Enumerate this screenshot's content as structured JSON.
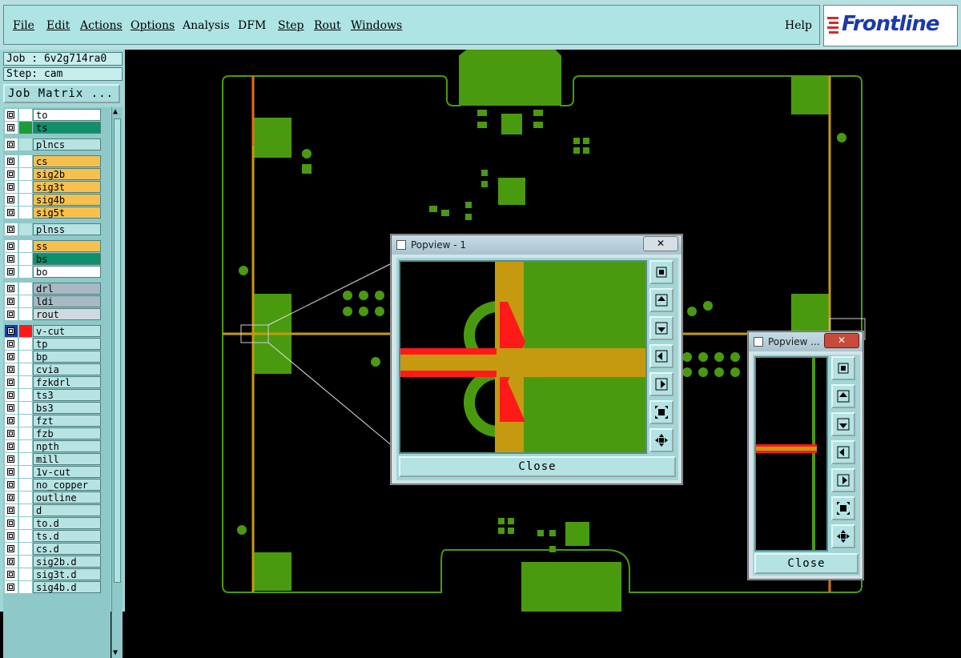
{
  "menu": {
    "file": "File",
    "edit": "Edit",
    "actions": "Actions",
    "options": "Options",
    "analysis": "Analysis",
    "dfm": "DFM",
    "step": "Step",
    "rout": "Rout",
    "windows": "Windows",
    "help": "Help"
  },
  "brand": {
    "name": "Frontline",
    "color": "#1a3aa8"
  },
  "info": {
    "job": "Job : 6v2g714ra0",
    "step": "Step: cam",
    "job_matrix": "Job Matrix ..."
  },
  "layers": [
    {
      "name": "to",
      "color": "#ffffff",
      "swatch": "#ffffff",
      "group": 0
    },
    {
      "name": "ts",
      "color": "#0f8f6a",
      "swatch": "#1f9a3a",
      "group": 0
    },
    {
      "name": "plncs",
      "color": "#b8e3e3",
      "swatch": "#b8e3e3",
      "group": 1
    },
    {
      "name": "cs",
      "color": "#f6c04f",
      "swatch": "#ffffff",
      "group": 2
    },
    {
      "name": "sig2b",
      "color": "#f6c04f",
      "swatch": "#ffffff",
      "group": 2
    },
    {
      "name": "sig3t",
      "color": "#f6c04f",
      "swatch": "#ffffff",
      "group": 2
    },
    {
      "name": "sig4b",
      "color": "#f6c04f",
      "swatch": "#ffffff",
      "group": 2
    },
    {
      "name": "sig5t",
      "color": "#f6c04f",
      "swatch": "#ffffff",
      "group": 2
    },
    {
      "name": "plnss",
      "color": "#b8e3e3",
      "swatch": "#b8e3e3",
      "group": 3
    },
    {
      "name": "ss",
      "color": "#f6c04f",
      "swatch": "#ffffff",
      "group": 4
    },
    {
      "name": "bs",
      "color": "#0f8f6a",
      "swatch": "#ffffff",
      "group": 4
    },
    {
      "name": "bo",
      "color": "#ffffff",
      "swatch": "#ffffff",
      "group": 4
    },
    {
      "name": "drl",
      "color": "#a9b9c3",
      "swatch": "#ffffff",
      "group": 5
    },
    {
      "name": "ldi",
      "color": "#a9b9c3",
      "swatch": "#ffffff",
      "group": 5
    },
    {
      "name": "rout",
      "color": "#cfdadf",
      "swatch": "#ffffff",
      "group": 5
    },
    {
      "name": "v-cut",
      "color": "#b8e3e3",
      "swatch": "#ff1a1a",
      "group": 6,
      "active": true
    },
    {
      "name": "tp",
      "color": "#b8e3e3",
      "swatch": "#ffffff",
      "group": 6
    },
    {
      "name": "bp",
      "color": "#b8e3e3",
      "swatch": "#ffffff",
      "group": 6
    },
    {
      "name": "cvia",
      "color": "#b8e3e3",
      "swatch": "#ffffff",
      "group": 6
    },
    {
      "name": "fzkdrl",
      "color": "#b8e3e3",
      "swatch": "#ffffff",
      "group": 6
    },
    {
      "name": "ts3",
      "color": "#b8e3e3",
      "swatch": "#ffffff",
      "group": 6
    },
    {
      "name": "bs3",
      "color": "#b8e3e3",
      "swatch": "#ffffff",
      "group": 6
    },
    {
      "name": "fzt",
      "color": "#b8e3e3",
      "swatch": "#ffffff",
      "group": 6
    },
    {
      "name": "fzb",
      "color": "#b8e3e3",
      "swatch": "#ffffff",
      "group": 6
    },
    {
      "name": "npth",
      "color": "#b8e3e3",
      "swatch": "#ffffff",
      "group": 6
    },
    {
      "name": "mill",
      "color": "#b8e3e3",
      "swatch": "#ffffff",
      "group": 6
    },
    {
      "name": "1v-cut",
      "color": "#b8e3e3",
      "swatch": "#ffffff",
      "group": 6
    },
    {
      "name": "no_copper",
      "color": "#b8e3e3",
      "swatch": "#ffffff",
      "group": 6
    },
    {
      "name": "outline",
      "color": "#b8e3e3",
      "swatch": "#ffffff",
      "group": 6
    },
    {
      "name": "d",
      "color": "#b8e3e3",
      "swatch": "#ffffff",
      "group": 6
    },
    {
      "name": "to.d",
      "color": "#b8e3e3",
      "swatch": "#ffffff",
      "group": 6
    },
    {
      "name": "ts.d",
      "color": "#b8e3e3",
      "swatch": "#ffffff",
      "group": 6
    },
    {
      "name": "cs.d",
      "color": "#b8e3e3",
      "swatch": "#ffffff",
      "group": 6
    },
    {
      "name": "sig2b.d",
      "color": "#b8e3e3",
      "swatch": "#ffffff",
      "group": 6
    },
    {
      "name": "sig3t.d",
      "color": "#b8e3e3",
      "swatch": "#ffffff",
      "group": 6
    },
    {
      "name": "sig4b.d",
      "color": "#b8e3e3",
      "swatch": "#ffffff",
      "group": 6
    }
  ],
  "popview1": {
    "title": "Popview - 1",
    "close_x": "✕",
    "close_label": "Close"
  },
  "popview2": {
    "title": "Popview ...",
    "close_x": "✕",
    "close_label": "Close"
  },
  "colors": {
    "board": "#4a9a10",
    "rout": "#c59a10",
    "vcut": "#ff1a1a",
    "bg": "#000000"
  }
}
